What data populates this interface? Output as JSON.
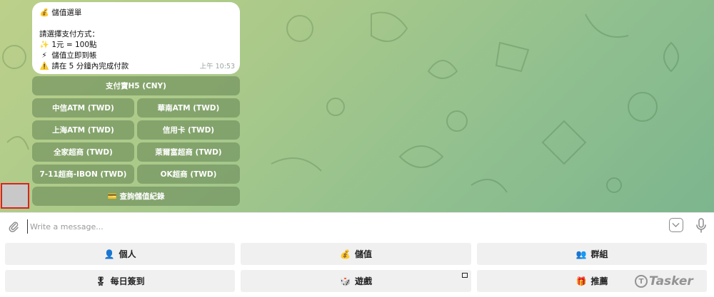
{
  "message": {
    "title_icon": "💰",
    "title": "儲值選單",
    "prompt": "請選擇支付方式：",
    "rate_icon": "✨",
    "rate": "1元 = 100點",
    "instant_icon": "⚡",
    "instant": "儲值立即到帳",
    "warn_icon": "⚠️",
    "deadline": "請在 5 分鐘內完成付款",
    "time": "上午 10:53"
  },
  "inline_keyboard": {
    "pay_h5": "支付寶H5 (CNY)",
    "ctbc_atm": "中信ATM (TWD)",
    "hncb_atm": "華南ATM (TWD)",
    "scsb_atm": "上海ATM (TWD)",
    "credit_card": "信用卡 (TWD)",
    "familymart": "全家超商 (TWD)",
    "hilife": "萊爾富超商 (TWD)",
    "seven_ibon": "7-11超商-IBON (TWD)",
    "ok_mart": "OK超商 (TWD)",
    "history_icon": "💳",
    "history": "查詢儲值紀錄"
  },
  "composer": {
    "placeholder": "Write a message..."
  },
  "reply_keyboard": {
    "profile_icon": "👤",
    "profile": "個人",
    "topup_icon": "💰",
    "topup": "儲值",
    "groups_icon": "👥",
    "groups": "群組",
    "checkin_icon": "🎖",
    "checkin": "每日簽到",
    "games_icon": "🎲",
    "games": "遊戲",
    "referral_icon": "🎁",
    "referral": "推薦"
  },
  "watermark": "Tasker",
  "colors": {
    "chat_bg_start": "#bcd08a",
    "chat_bg_end": "#7db58e",
    "inline_button": "#6c8c5a",
    "highlight_box": "#e0201f"
  }
}
